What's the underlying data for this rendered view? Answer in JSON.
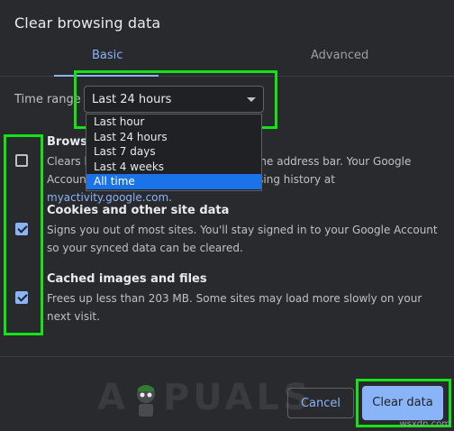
{
  "dialog": {
    "title": "Clear browsing data"
  },
  "tabs": [
    {
      "label": "Basic",
      "active": true
    },
    {
      "label": "Advanced",
      "active": false
    }
  ],
  "time_range": {
    "label": "Time range",
    "value": "Last 24 hours",
    "options": [
      "Last hour",
      "Last 24 hours",
      "Last 7 days",
      "Last 4 weeks",
      "All time"
    ],
    "highlighted_option": "All time"
  },
  "options": [
    {
      "title": "Browsing history",
      "desc_part1": "Clears history and autocompletions in the address bar. Your Google Account may have",
      "desc_part2": "other forms of browsing history at ",
      "link": "myactivity.google.com",
      "desc_part3": ".",
      "checked": false
    },
    {
      "title": "Cookies and other site data",
      "desc": "Signs you out of most sites. You'll stay signed in to your Google Account so your synced data can be cleared.",
      "checked": true
    },
    {
      "title": "Cached images and files",
      "desc": "Frees up less than 203 MB. Some sites may load more slowly on your next visit.",
      "checked": true
    }
  ],
  "footer": {
    "cancel_label": "Cancel",
    "clear_label": "Clear data"
  },
  "branding": {
    "logo_left": "A",
    "logo_right": "PUALS",
    "watermark": "wsxdn.com"
  },
  "colors": {
    "background": "#292a2d",
    "accent": "#8ab4f8",
    "highlight": "#16e316",
    "selected_option": "#1a73e8"
  }
}
